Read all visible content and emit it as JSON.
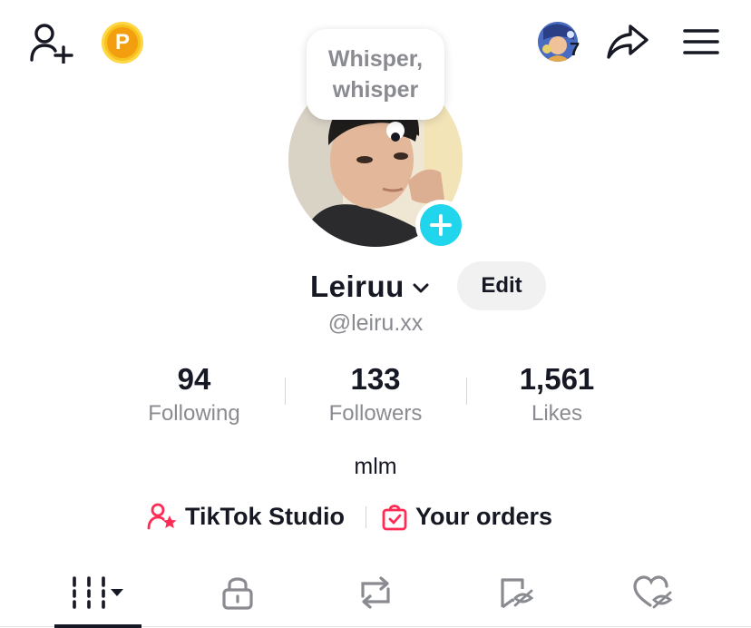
{
  "header": {
    "add_friend_icon": "person-plus-icon",
    "points_icon": "coin-p-icon",
    "points_letter": "P",
    "friend_notification_count": "7",
    "share_icon": "share-arrow-icon",
    "menu_icon": "hamburger-menu-icon"
  },
  "profile": {
    "note_bubble_text": "Whisper, whisper",
    "display_name": "Leiruu",
    "edit_label": "Edit",
    "handle": "@leiru.xx",
    "bio": "mlm"
  },
  "stats": [
    {
      "value": "94",
      "label": "Following"
    },
    {
      "value": "133",
      "label": "Followers"
    },
    {
      "value": "1,561",
      "label": "Likes"
    }
  ],
  "links": {
    "studio_label": "TikTok Studio",
    "orders_label": "Your orders"
  },
  "tabs": [
    {
      "icon": "videos-grid-icon"
    },
    {
      "icon": "lock-icon"
    },
    {
      "icon": "repost-icon"
    },
    {
      "icon": "saved-icon"
    },
    {
      "icon": "liked-icon"
    }
  ],
  "colors": {
    "accent_cyan": "#20d5ec",
    "brand_pink": "#fe2c55",
    "coin_gold": "#f7c21d",
    "text_primary": "#161823",
    "text_secondary": "#8a8b91"
  }
}
